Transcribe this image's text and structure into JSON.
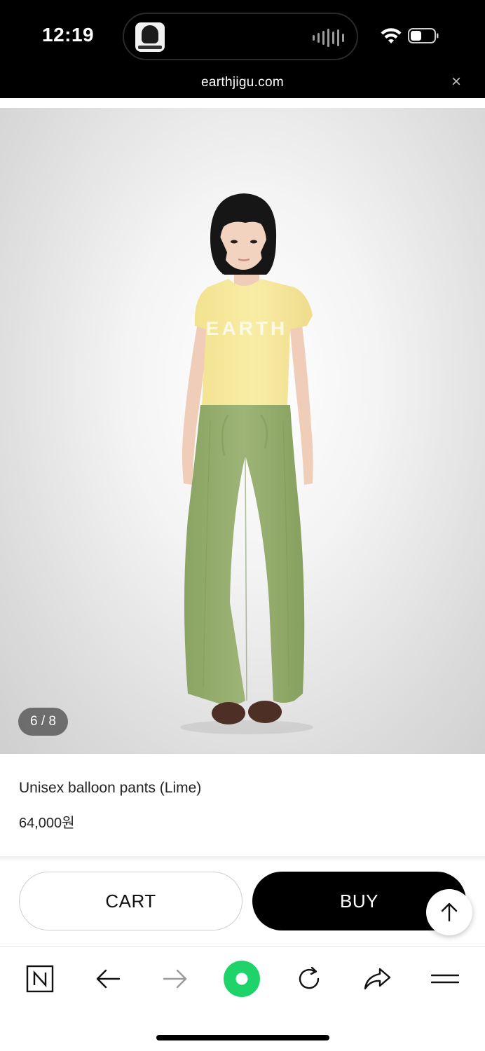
{
  "status_bar": {
    "time": "12:19"
  },
  "browser": {
    "url": "earthjigu.com",
    "close_glyph": "×"
  },
  "gallery": {
    "counter": "6 / 8",
    "image_alt": "Model wearing lime balloon pants and yellow tee"
  },
  "product": {
    "name": "Unisex balloon pants (Lime)",
    "price": "64,000원"
  },
  "actions": {
    "cart_label": "CART",
    "buy_label": "BUY"
  },
  "toolbar": {
    "items": [
      "naver-home-icon",
      "back-arrow-icon",
      "forward-arrow-icon",
      "green-dot-icon",
      "refresh-icon",
      "share-icon",
      "menu-icon"
    ]
  },
  "colors": {
    "accent_green": "#1ed46a",
    "pants": "#95ad6e",
    "tee": "#f7eaa0"
  }
}
